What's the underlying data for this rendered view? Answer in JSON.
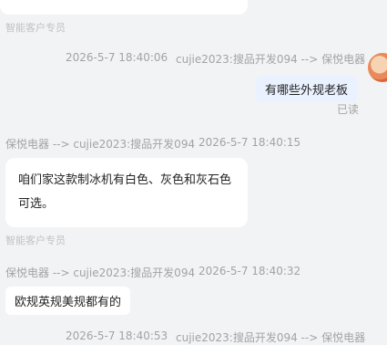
{
  "messages": [
    {
      "sender_tag": "智能客户专员",
      "direction": "incoming",
      "text": ""
    },
    {
      "direction": "outgoing",
      "time": "2026-5-7 18:40:06",
      "route": "cujie2023:搜品开发094 --> 保悦电器",
      "text": "有哪些外规老板",
      "status": "已读"
    },
    {
      "direction": "incoming",
      "route": "保悦电器 --> cujie2023:搜品开发094",
      "time": "2026-5-7 18:40:15",
      "text": "咱们家这款制冰机有白色、灰色和灰石色可选。",
      "sender_tag": "智能客户专员"
    },
    {
      "direction": "incoming",
      "route": "保悦电器 --> cujie2023:搜品开发094",
      "time": "2026-5-7 18:40:32",
      "text": "欧规英规美规都有的"
    },
    {
      "direction": "outgoing",
      "time": "2026-5-7 18:40:53",
      "route": "cujie2023:搜品开发094 --> 保悦电器"
    }
  ],
  "colors": {
    "background": "#f2f3f5",
    "incoming_bubble": "#ffffff",
    "outgoing_bubble": "#eaf1ff"
  }
}
